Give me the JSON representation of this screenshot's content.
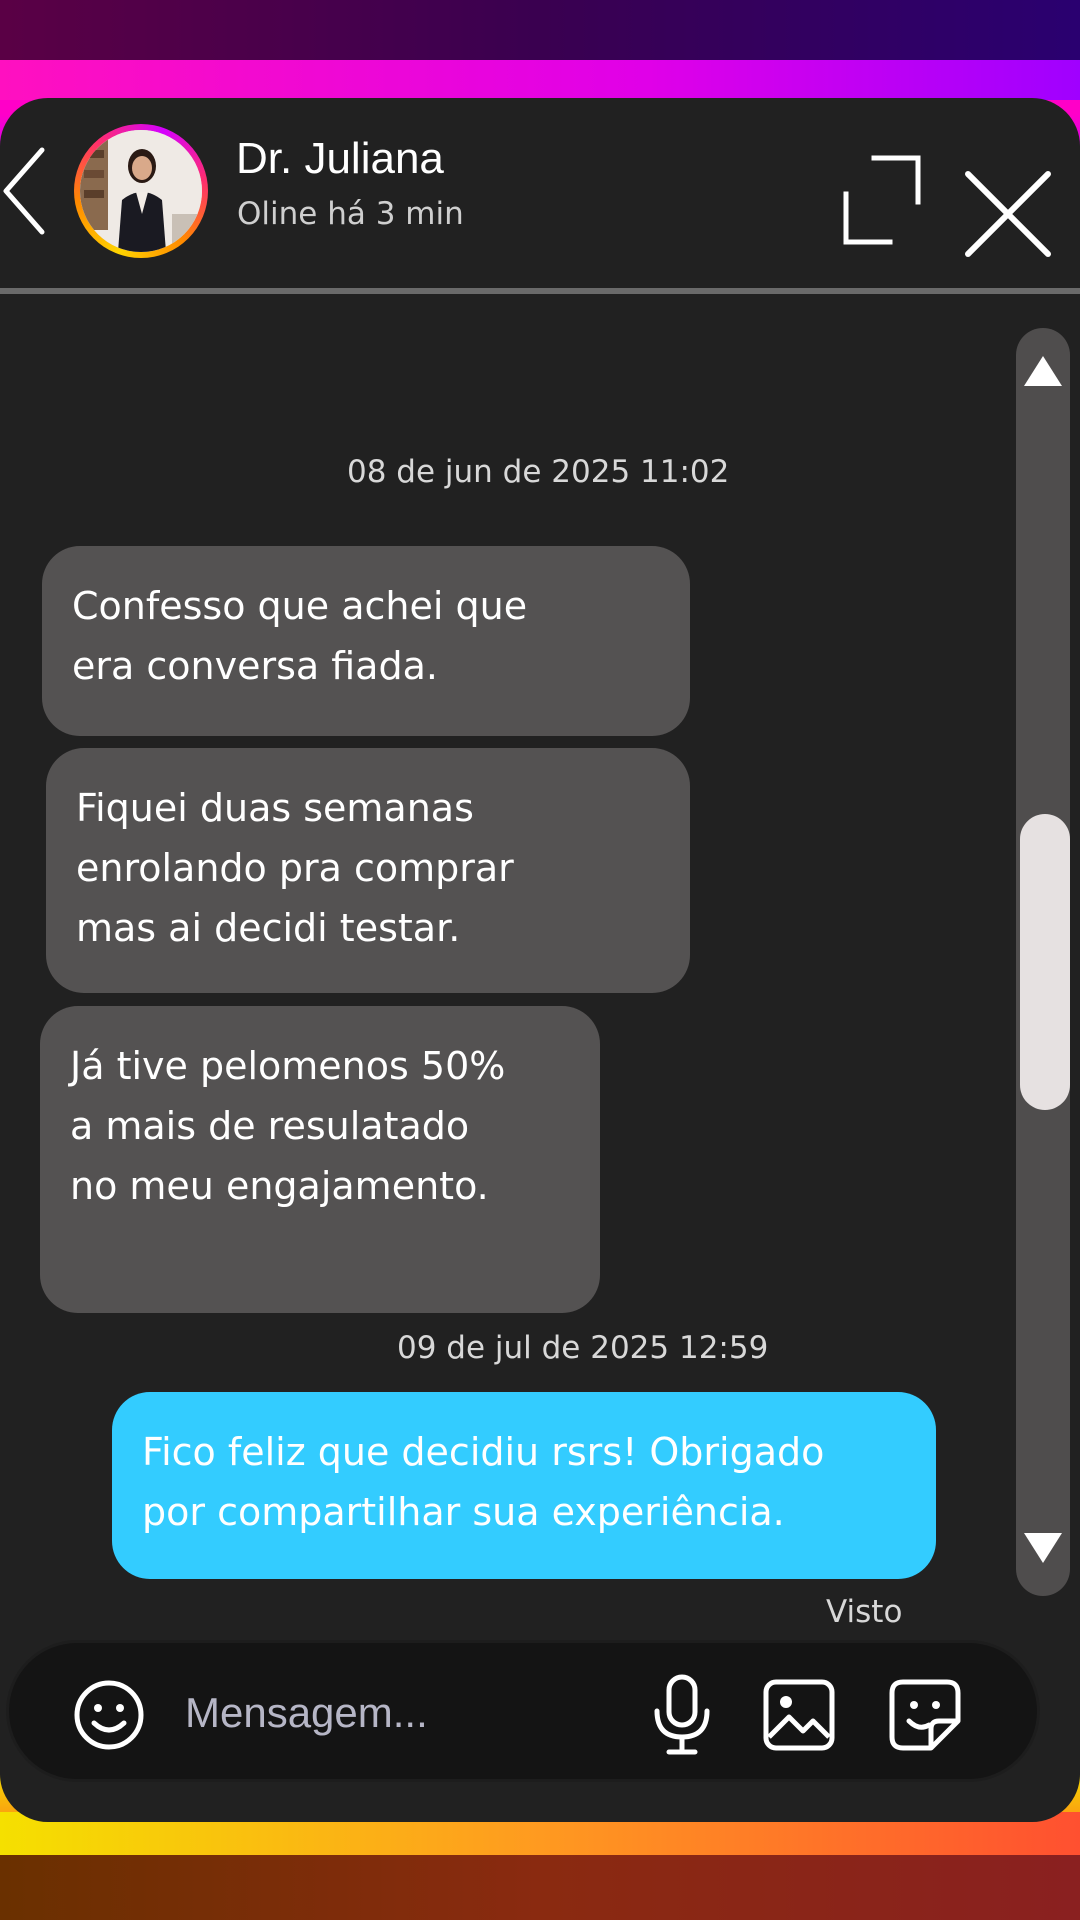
{
  "header": {
    "contact_name": "Dr. Juliana",
    "status": "Oline há 3 min"
  },
  "messages": [
    {
      "type": "timestamp",
      "text": "08 de jun de 2025 11:02"
    },
    {
      "type": "received",
      "text": "Confesso que achei que\nera conversa fiada."
    },
    {
      "type": "received",
      "text": "Fiquei duas semanas\nenrolando pra comprar\nmas ai decidi testar."
    },
    {
      "type": "received",
      "text": "Já tive pelomenos 50%\na mais de resulatado\nno meu engajamento."
    },
    {
      "type": "timestamp",
      "text": "09 de jul de 2025 12:59"
    },
    {
      "type": "sent",
      "text": "Fico feliz que decidiu rsrs! Obrigado\npor compartilhar sua experiência."
    }
  ],
  "seen_label": "Visto",
  "composer": {
    "placeholder": "Mensagem..."
  },
  "colors": {
    "card_bg": "#212121",
    "received_bubble": "#545252",
    "sent_bubble": "#33ccff",
    "scroll_thumb": "#e6e1e1"
  }
}
